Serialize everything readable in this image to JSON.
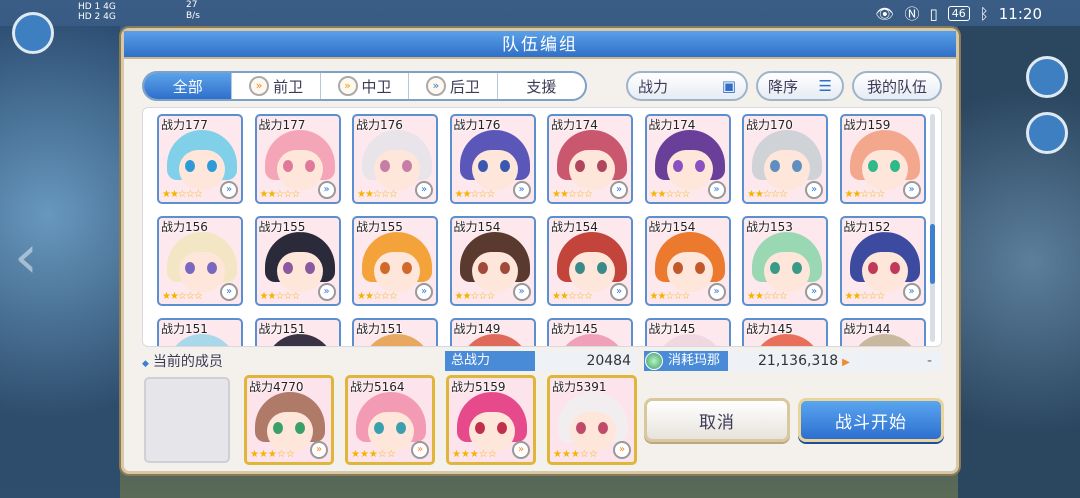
{
  "status_bar": {
    "network_left": "HD 1 4G\nHD 2 4G",
    "speed_value": "27",
    "speed_unit": "B/s",
    "battery": "46",
    "time": "11:20"
  },
  "dialog": {
    "title": "队伍编组"
  },
  "filter_tabs": [
    {
      "label": "全部",
      "active": true,
      "icon": ""
    },
    {
      "label": "前卫",
      "active": false,
      "icon": "vanguard-icon"
    },
    {
      "label": "中卫",
      "active": false,
      "icon": "midguard-icon"
    },
    {
      "label": "后卫",
      "active": false,
      "icon": "rearguard-icon"
    },
    {
      "label": "支援",
      "active": false,
      "icon": ""
    }
  ],
  "sort": {
    "field_label": "战力",
    "order_label": "降序",
    "my_team_label": "我的队伍"
  },
  "roster": {
    "row1": [
      {
        "power": "战力177",
        "hair": "#7fd0e8",
        "eye": "#2f9bd6"
      },
      {
        "power": "战力177",
        "hair": "#f4a6b8",
        "eye": "#e07a9a"
      },
      {
        "power": "战力176",
        "hair": "#e9e4ea",
        "eye": "#c77ea6"
      },
      {
        "power": "战力176",
        "hair": "#5a57b8",
        "eye": "#3a58b0"
      },
      {
        "power": "战力174",
        "hair": "#c9586f",
        "eye": "#b0455e"
      },
      {
        "power": "战力174",
        "hair": "#6a3f9a",
        "eye": "#8a4fc0"
      },
      {
        "power": "战力170",
        "hair": "#cfd2d6",
        "eye": "#5f8fc0"
      },
      {
        "power": "战力159",
        "hair": "#f3a88e",
        "eye": "#2fb88a"
      }
    ],
    "row2": [
      {
        "power": "战力156",
        "hair": "#f3e6c4",
        "eye": "#7a68c0"
      },
      {
        "power": "战力155",
        "hair": "#2a2a3a",
        "eye": "#8a5aa0"
      },
      {
        "power": "战力155",
        "hair": "#f3a33a",
        "eye": "#d06a2a"
      },
      {
        "power": "战力154",
        "hair": "#5a3a2e",
        "eye": "#a04a3a"
      },
      {
        "power": "战力154",
        "hair": "#c2443a",
        "eye": "#3a8a8a"
      },
      {
        "power": "战力154",
        "hair": "#ec7a2e",
        "eye": "#c05a2a"
      },
      {
        "power": "战力153",
        "hair": "#9ad8b4",
        "eye": "#3a9a8a"
      },
      {
        "power": "战力152",
        "hair": "#3c4aa0",
        "eye": "#c03a5a"
      }
    ],
    "row3": [
      {
        "power": "战力151",
        "hair": "#a8d8ea",
        "eye": "#4a8ac0"
      },
      {
        "power": "战力151",
        "hair": "#3a3346",
        "eye": "#7a4a8a"
      },
      {
        "power": "战力151",
        "hair": "#e8a860",
        "eye": "#6a4a8a"
      },
      {
        "power": "战力149",
        "hair": "#e06a5a",
        "eye": "#c04a4a"
      },
      {
        "power": "战力145",
        "hair": "#f0a0b8",
        "eye": "#c05a8a"
      },
      {
        "power": "战力145",
        "hair": "#f0d8e0",
        "eye": "#8a6ac0"
      },
      {
        "power": "战力145",
        "hair": "#e8705a",
        "eye": "#c04a3a"
      },
      {
        "power": "战力144",
        "hair": "#c9b8a0",
        "eye": "#7a6a5a"
      }
    ]
  },
  "current_members": {
    "label": "当前的成员",
    "total_power_label": "总战力",
    "total_power_value": "20484",
    "mana_label": "消耗玛那",
    "mana_value": "21,136,318",
    "mana_after": "-",
    "members": [
      {
        "power": "战力4770",
        "hair": "#b07a68",
        "eye": "#3aa06a"
      },
      {
        "power": "战力5164",
        "hair": "#f39ab4",
        "eye": "#3aa0b0"
      },
      {
        "power": "战力5159",
        "hair": "#e64a8a",
        "eye": "#c0304a"
      },
      {
        "power": "战力5391",
        "hair": "#f2eef0",
        "eye": "#c04a6a"
      }
    ]
  },
  "actions": {
    "cancel_label": "取消",
    "start_label": "战斗开始"
  },
  "colors": {
    "accent_blue": "#2f6fcb",
    "gold_border": "#e0b63a",
    "star": "#f4b400"
  }
}
